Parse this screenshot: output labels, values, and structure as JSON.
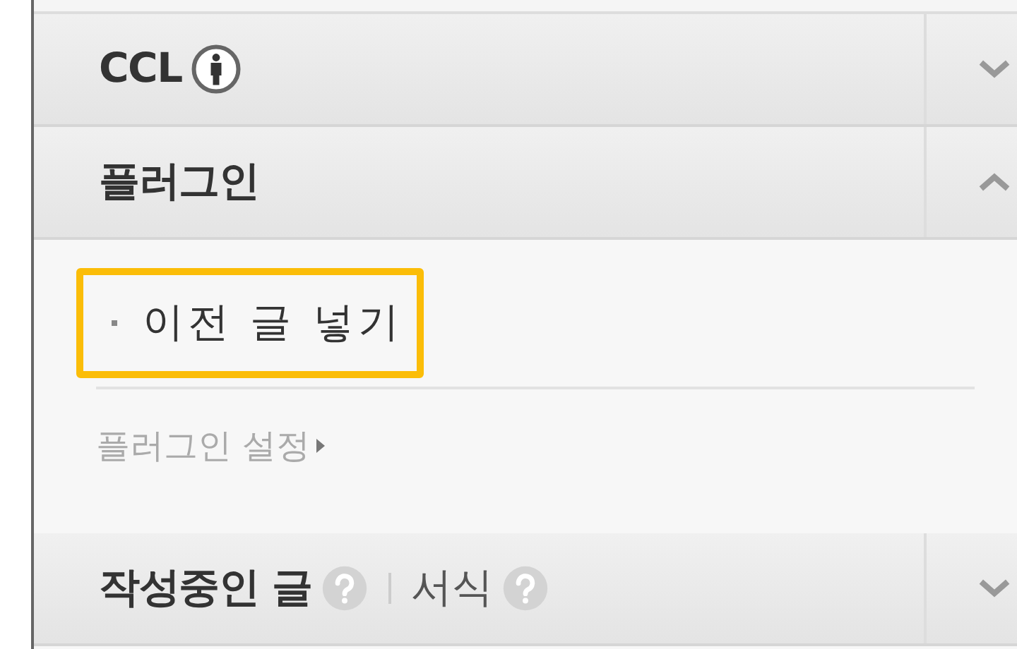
{
  "sections": [
    {
      "kind": "license",
      "title": "CCL",
      "expanded": false
    },
    {
      "kind": "plain",
      "title": "플러그인",
      "expanded": true,
      "items": [
        {
          "label": "이전 글 넣기",
          "highlighted": true
        }
      ],
      "settings_link": "플러그인 설정"
    },
    {
      "kind": "help",
      "title": "작성중인 글",
      "help": [
        {
          "label": "서식"
        }
      ],
      "expanded": false
    }
  ]
}
